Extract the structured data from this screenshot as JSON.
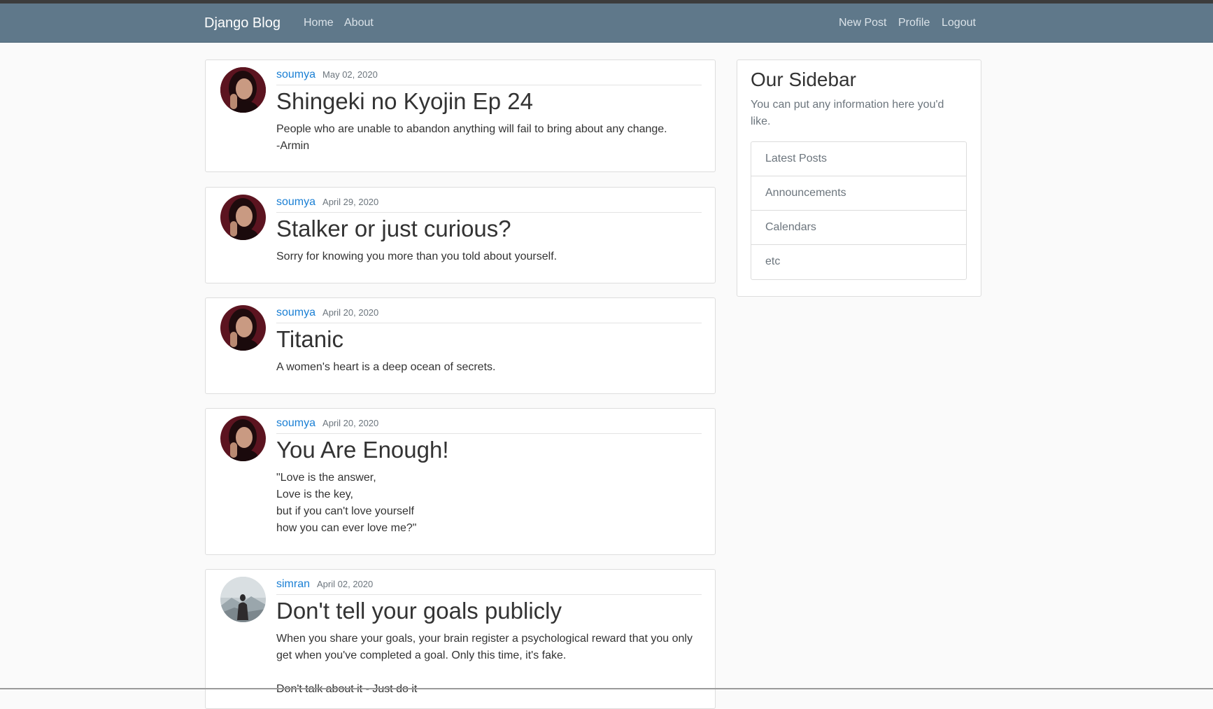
{
  "navbar": {
    "brand": "Django Blog",
    "left_links": [
      "Home",
      "About"
    ],
    "right_links": [
      "New Post",
      "Profile",
      "Logout"
    ]
  },
  "posts": [
    {
      "author": "soumya",
      "date": "May 02, 2020",
      "title": "Shingeki no Kyojin Ep 24",
      "body": [
        "People who are unable to abandon anything will fail to bring about any change.",
        "-Armin"
      ]
    },
    {
      "author": "soumya",
      "date": "April 29, 2020",
      "title": "Stalker or just curious?",
      "body": [
        "Sorry for knowing you more than you told about yourself."
      ]
    },
    {
      "author": "soumya",
      "date": "April 20, 2020",
      "title": "Titanic",
      "body": [
        "A women's heart is a deep ocean of secrets."
      ]
    },
    {
      "author": "soumya",
      "date": "April 20, 2020",
      "title": "You Are Enough!",
      "body": [
        "\"Love is the answer,",
        "Love is the key,",
        "but if you can't love yourself",
        "how you can ever love me?\""
      ]
    },
    {
      "author": "simran",
      "date": "April 02, 2020",
      "title": "Don't tell your goals publicly",
      "body": [
        "When you share your goals, your brain register a psychological reward that you only",
        "get when you've completed a goal. Only this time, it's fake.",
        "",
        "Don't talk about it - Just do it"
      ]
    }
  ],
  "sidebar": {
    "title": "Our Sidebar",
    "text": "You can put any information here you'd like.",
    "items": [
      "Latest Posts",
      "Announcements",
      "Calendars",
      "etc"
    ]
  },
  "colors": {
    "navbar": "#5f788a",
    "link": "#1a7fd4",
    "background": "#fafafa"
  }
}
